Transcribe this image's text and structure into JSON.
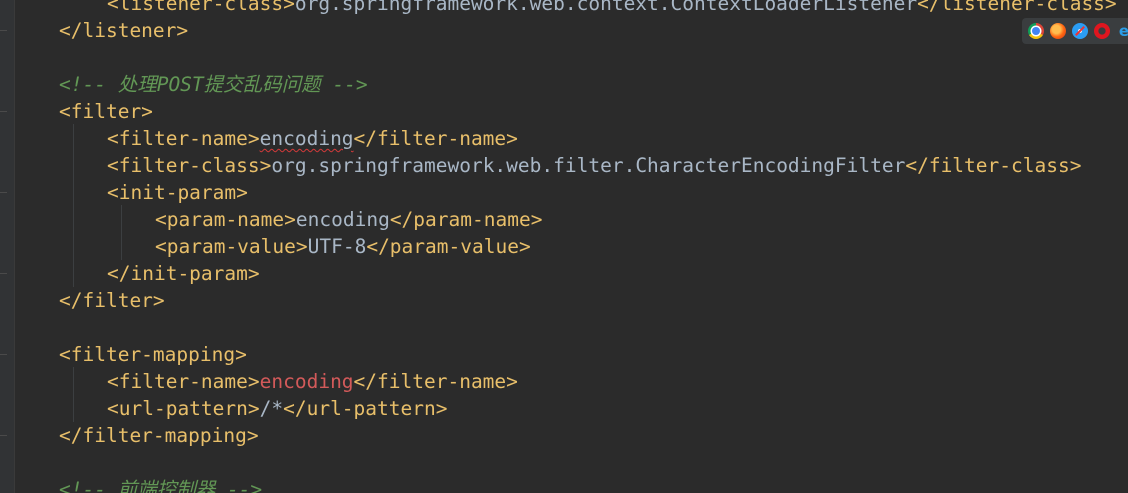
{
  "code": {
    "l1": {
      "open": "<listener-class>",
      "text": "org.springframework.web.context.ContextLoaderListener",
      "close": "</listener-class>"
    },
    "l2": {
      "tag": "</listener>"
    },
    "l4": {
      "comment": "<!-- 处理POST提交乱码问题 -->"
    },
    "l5": {
      "tag": "<filter>"
    },
    "l6": {
      "open": "<filter-name>",
      "text": "encoding",
      "close": "</filter-name>"
    },
    "l7": {
      "open": "<filter-class>",
      "text": "org.springframework.web.filter.CharacterEncodingFilter",
      "close": "</filter-class>"
    },
    "l8": {
      "tag": "<init-param>"
    },
    "l9": {
      "open": "<param-name>",
      "text": "encoding",
      "close": "</param-name>"
    },
    "l10": {
      "open": "<param-value>",
      "text": "UTF-8",
      "close": "</param-value>"
    },
    "l11": {
      "tag": "</init-param>"
    },
    "l12": {
      "tag": "</filter>"
    },
    "l14": {
      "tag": "<filter-mapping>"
    },
    "l15": {
      "open": "<filter-name>",
      "text": "encoding",
      "close": "</filter-name>"
    },
    "l16": {
      "open": "<url-pattern>",
      "text": "/*",
      "close": "</url-pattern>"
    },
    "l17": {
      "tag": "</filter-mapping>"
    },
    "l19": {
      "comment": "<!-- 前端控制器 -->"
    }
  },
  "colors": {
    "background": "#2b2b2b",
    "tag": "#e8bf6a",
    "text": "#a9b7c6",
    "highlight_text": "#d35a5a",
    "comment": "#629755",
    "error_underline": "#d33a3a"
  },
  "browser_icons": [
    "chrome-icon",
    "firefox-icon",
    "safari-icon",
    "opera-icon",
    "ie-icon"
  ],
  "browser_icon_labels": {
    "ie": "e"
  }
}
